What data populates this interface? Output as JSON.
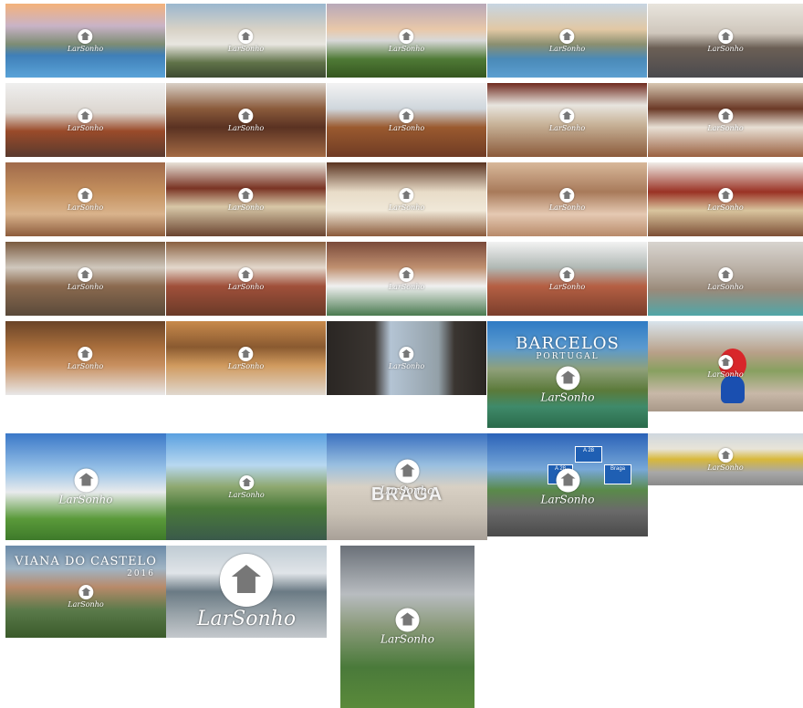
{
  "gallery": {
    "watermark_text": "LarSonho",
    "barcelos": {
      "title": "BARCELOS",
      "subtitle": "PORTUGAL"
    },
    "braga": {
      "sign_text": "BRAGA"
    },
    "highway": {
      "sign_main": "A 28",
      "sign_left": "A 28",
      "sign_right": "Braga"
    },
    "viana": {
      "title": "VIANA DO CASTELO",
      "year": "2016"
    }
  }
}
